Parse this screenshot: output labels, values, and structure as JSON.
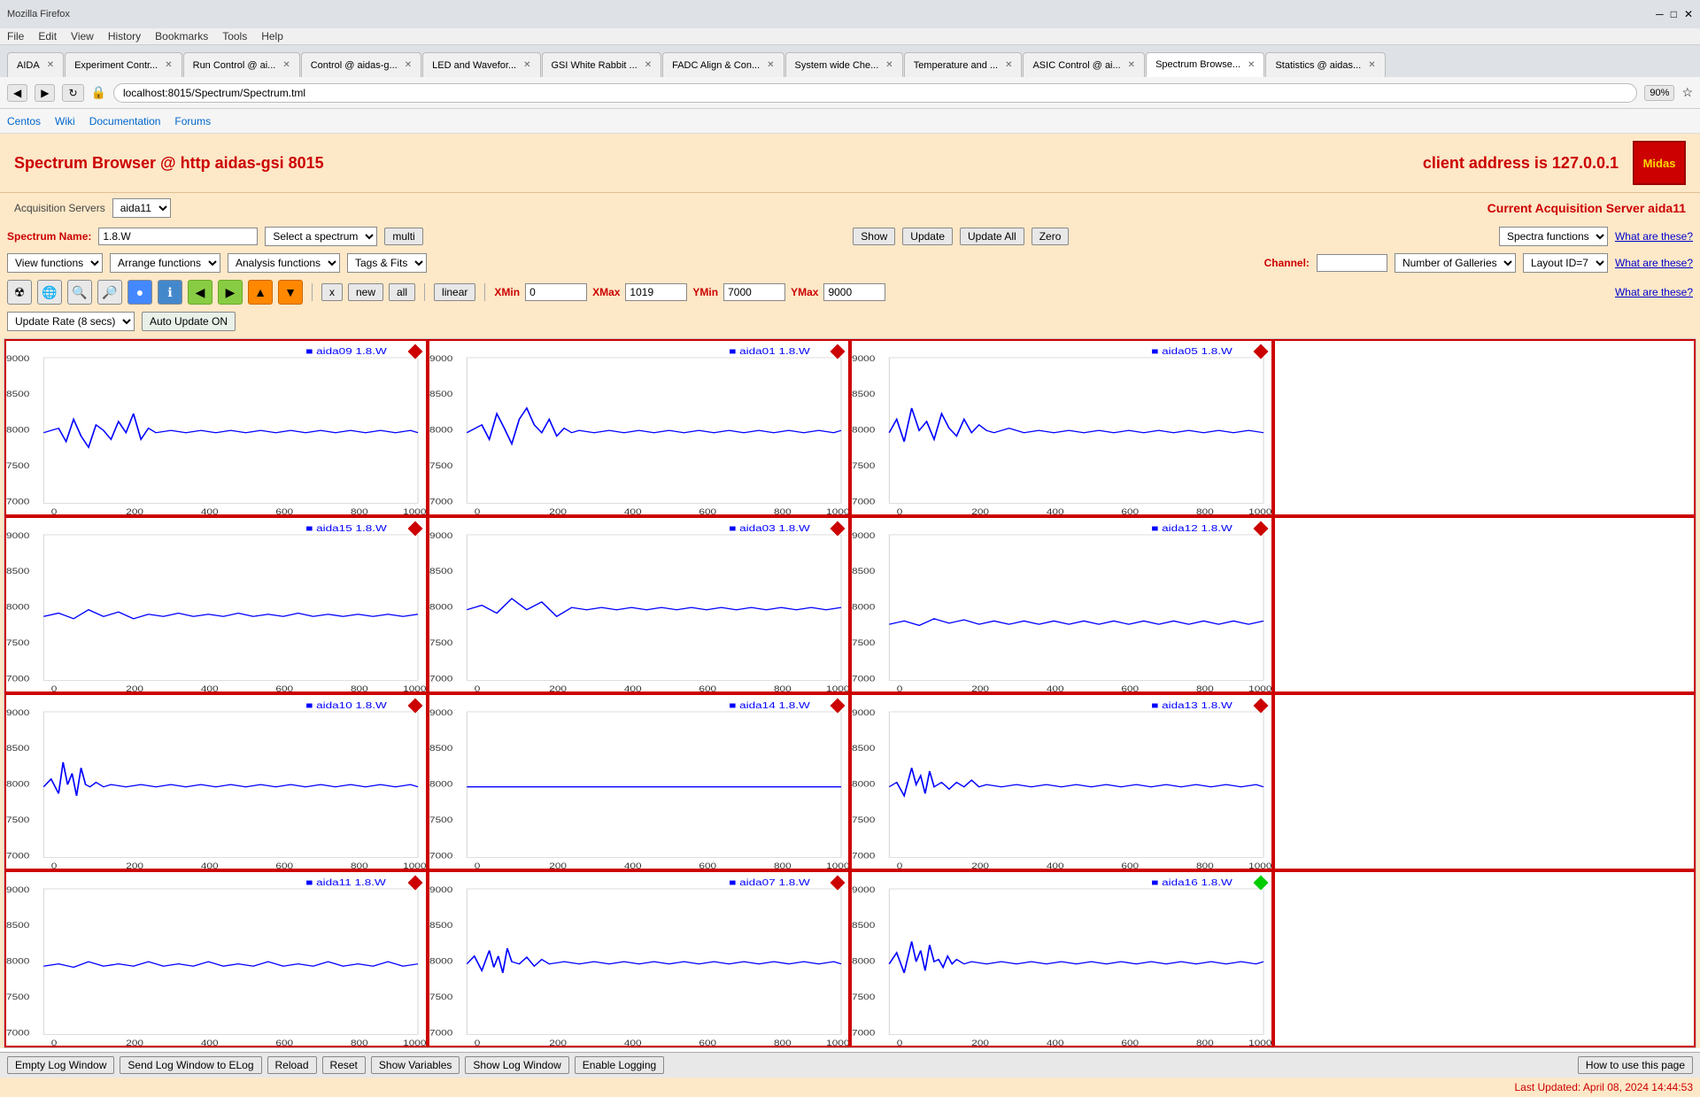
{
  "browser": {
    "menu_items": [
      "File",
      "Edit",
      "View",
      "History",
      "Bookmarks",
      "Tools",
      "Help"
    ],
    "tabs": [
      {
        "label": "AIDA",
        "active": false
      },
      {
        "label": "Experiment Contr...",
        "active": false
      },
      {
        "label": "Run Control @ ai...",
        "active": false
      },
      {
        "label": "Control @ aidas-g...",
        "active": false
      },
      {
        "label": "LED and Wavefor...",
        "active": false
      },
      {
        "label": "GSI White Rabbit ...",
        "active": false
      },
      {
        "label": "FADC Align & Con...",
        "active": false
      },
      {
        "label": "System wide Che...",
        "active": false
      },
      {
        "label": "Temperature and ...",
        "active": false
      },
      {
        "label": "ASIC Control @ ai...",
        "active": false
      },
      {
        "label": "Spectrum Browse...",
        "active": true
      },
      {
        "label": "Statistics @ aidas...",
        "active": false
      }
    ],
    "url": "localhost:8015/Spectrum/Spectrum.tml",
    "zoom": "90%",
    "bookmarks": [
      "Centos",
      "Wiki",
      "Documentation",
      "Forums"
    ]
  },
  "page": {
    "title": "Spectrum Browser @ http aidas-gsi 8015",
    "client_address": "client address is 127.0.0.1",
    "acq_servers_label": "Acquisition Servers",
    "acq_server_value": "aida11",
    "current_server_label": "Current Acquisition Server aida11",
    "spectrum_name_label": "Spectrum Name:",
    "spectrum_name_value": "1.8.W",
    "select_spectrum_placeholder": "Select a spectrum",
    "multi_btn": "multi",
    "show_btn": "Show",
    "update_btn": "Update",
    "update_all_btn": "Update All",
    "zero_btn": "Zero",
    "spectra_functions": "Spectra functions",
    "what_are_these1": "What are these?",
    "view_functions": "View functions",
    "arrange_functions": "Arrange functions",
    "analysis_functions": "Analysis functions",
    "tags_fits": "Tags & Fits",
    "channel_label": "Channel:",
    "channel_value": "",
    "number_of_galleries": "Number of Galleries",
    "layout_id": "Layout ID=7",
    "what_are_these2": "What are these?",
    "x_btn": "x",
    "new_btn": "new",
    "all_btn": "all",
    "linear_btn": "linear",
    "xmin_label": "XMin",
    "xmin_value": "0",
    "xmax_label": "XMax",
    "xmax_value": "1019",
    "ymin_label": "YMin",
    "ymin_value": "7000",
    "ymax_label": "YMax",
    "ymax_value": "9000",
    "what_are_these3": "What are these?",
    "update_rate": "Update Rate (8 secs)",
    "auto_update": "Auto Update ON",
    "charts": [
      {
        "title": "aida09 1.8.W",
        "marker": "red",
        "row": 0,
        "col": 0
      },
      {
        "title": "aida01 1.8.W",
        "marker": "red",
        "row": 0,
        "col": 1
      },
      {
        "title": "aida05 1.8.W",
        "marker": "red",
        "row": 0,
        "col": 2
      },
      {
        "title": "",
        "marker": "",
        "row": 0,
        "col": 3,
        "empty": true
      },
      {
        "title": "aida15 1.8.W",
        "marker": "red",
        "row": 1,
        "col": 0
      },
      {
        "title": "aida03 1.8.W",
        "marker": "red",
        "row": 1,
        "col": 1
      },
      {
        "title": "aida12 1.8.W",
        "marker": "red",
        "row": 1,
        "col": 2
      },
      {
        "title": "",
        "marker": "",
        "row": 1,
        "col": 3,
        "empty": true
      },
      {
        "title": "aida10 1.8.W",
        "marker": "red",
        "row": 2,
        "col": 0
      },
      {
        "title": "aida14 1.8.W",
        "marker": "red",
        "row": 2,
        "col": 1
      },
      {
        "title": "aida13 1.8.W",
        "marker": "red",
        "row": 2,
        "col": 2
      },
      {
        "title": "",
        "marker": "",
        "row": 2,
        "col": 3,
        "empty": true
      },
      {
        "title": "aida11 1.8.W",
        "marker": "red",
        "row": 3,
        "col": 0
      },
      {
        "title": "aida07 1.8.W",
        "marker": "red",
        "row": 3,
        "col": 1
      },
      {
        "title": "aida16 1.8.W",
        "marker": "green",
        "row": 3,
        "col": 2
      },
      {
        "title": "",
        "marker": "",
        "row": 3,
        "col": 3,
        "empty": true
      }
    ],
    "bottom_buttons": [
      "Empty Log Window",
      "Send Log Window to ELog",
      "Reload",
      "Reset",
      "Show Variables",
      "Show Log Window",
      "Enable Logging"
    ],
    "how_to_use": "How to use this page",
    "last_updated": "Last Updated: April 08, 2024 14:44:53"
  }
}
